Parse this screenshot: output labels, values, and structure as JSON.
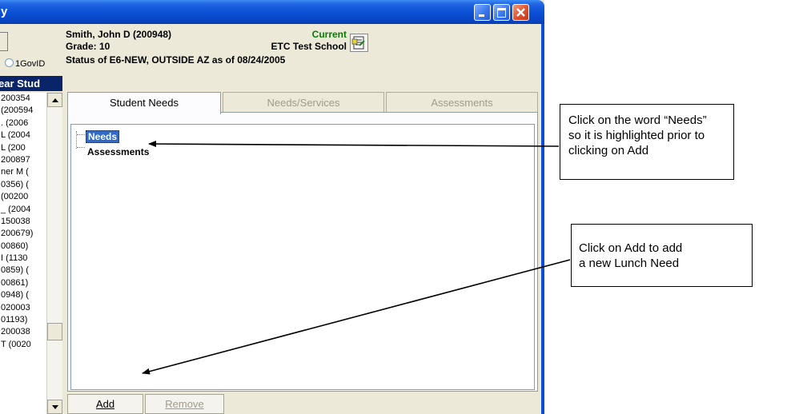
{
  "window": {
    "title": "y"
  },
  "left_panel": {
    "radio_label": "1GovID",
    "header": "ear Stud",
    "items": [
      "200354",
      "(200594",
      ". (2006",
      "L (2004",
      "L (200",
      "200897",
      "ner M (",
      "0356) (",
      "(00200",
      "_ (2004",
      "150038",
      "200679)",
      "00860)",
      "I (1130",
      "0859) (",
      "00861)",
      "0948) (",
      "020003",
      "01193)",
      "200038",
      "T (0020"
    ]
  },
  "student": {
    "name": "Smith, John D (200948)",
    "grade": "Grade: 10",
    "status": "Status of E6-NEW, OUTSIDE AZ as of 08/24/2005",
    "current": "Current",
    "school": "ETC Test School"
  },
  "tabs": [
    {
      "label": "Student Needs",
      "active": true
    },
    {
      "label": "Needs/Services",
      "active": false
    },
    {
      "label": "Assessments",
      "active": false
    }
  ],
  "tree": {
    "nodes": [
      "Needs",
      "Assessments"
    ]
  },
  "buttons": {
    "add": "Add",
    "remove": "Remove"
  },
  "callouts": {
    "needs": [
      "Click on the word “Needs”",
      "so it is highlighted prior to",
      "clicking on Add"
    ],
    "add": [
      "Click on Add to add",
      "a new Lunch Need"
    ]
  },
  "colors": {
    "titlebar": "#0a4fd4",
    "selection": "#316ac5",
    "current_status": "#008000",
    "list_header": "#0a246a"
  },
  "icons": [
    "minimize-icon",
    "maximize-icon",
    "close-icon",
    "document-icon",
    "scroll-up-icon",
    "scroll-down-icon"
  ]
}
